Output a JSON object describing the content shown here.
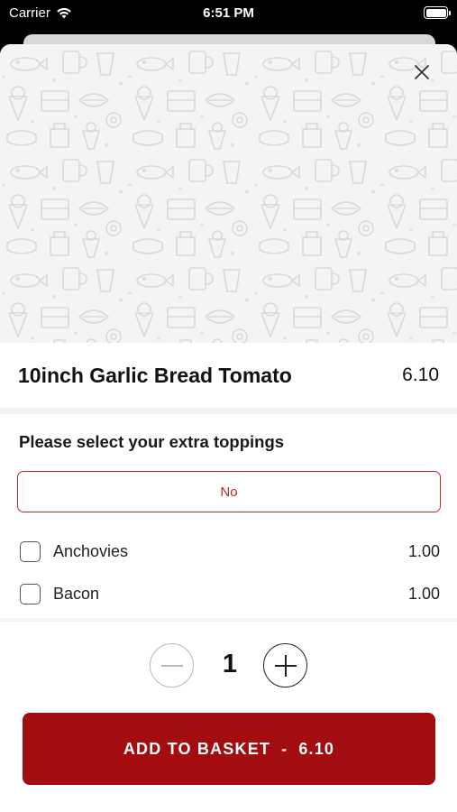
{
  "status_bar": {
    "carrier": "Carrier",
    "time": "6:51 PM"
  },
  "item": {
    "name": "10inch Garlic Bread Tomato",
    "price": "6.10"
  },
  "toppings": {
    "title": "Please select your extra toppings",
    "no_option_label": "No",
    "options": [
      {
        "label": "Anchovies",
        "price": "1.00",
        "checked": false
      },
      {
        "label": "Bacon",
        "price": "1.00",
        "checked": false
      }
    ]
  },
  "quantity": {
    "value": "1"
  },
  "add_button": {
    "label": "ADD TO BASKET",
    "separator": "-",
    "price": "6.10"
  },
  "colors": {
    "accent": "#a30d10",
    "no_border": "#c0282d"
  }
}
